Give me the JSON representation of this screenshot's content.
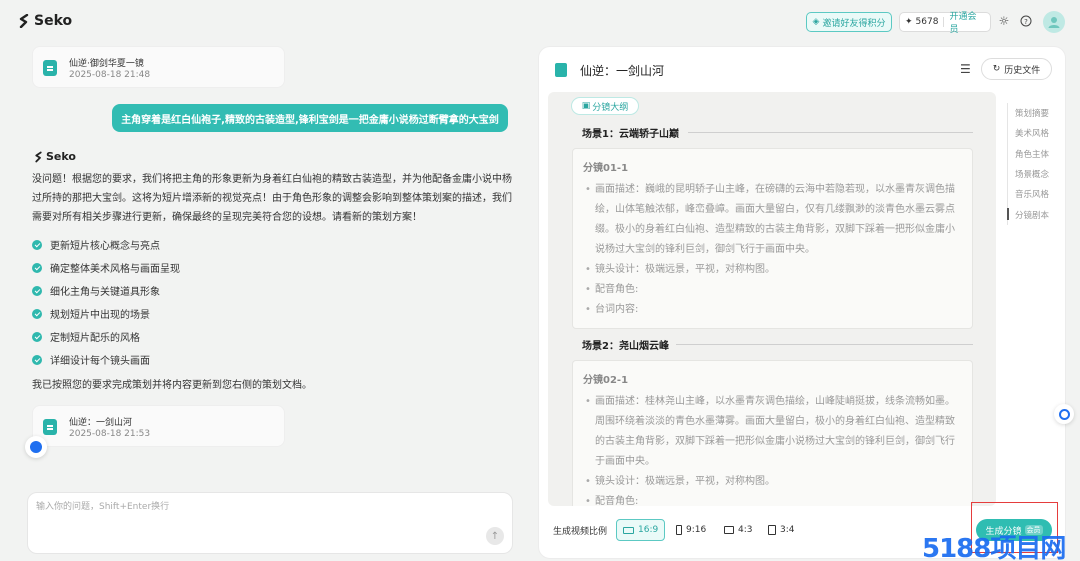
{
  "header": {
    "logo_text": "Seko",
    "invite_label": "邀请好友得积分",
    "credits_value": "5678",
    "vip_label": "开通会员"
  },
  "chat": {
    "file_cards": [
      {
        "name": "仙逆·御剑华夏一镜",
        "date": "2025-08-18 21:48"
      },
      {
        "name": "仙逆：一剑山河",
        "date": "2025-08-18 21:53"
      }
    ],
    "user_message": "主角穿着是红白仙袍子,精致的古装造型,锋利宝剑是一把金庸小说杨过断臂拿的大宝剑",
    "bot_name": "Seko",
    "bot_paragraph": "没问题！根据您的要求，我们将把主角的形象更新为身着红白仙袍的精致古装造型，并为他配备金庸小说中杨过所持的那把大宝剑。这将为短片增添新的视觉亮点！由于角色形象的调整会影响到整体策划案的描述，我们需要对所有相关步骤进行更新，确保最终的呈现完美符合您的设想。请看新的策划方案！",
    "checklist": [
      "更新短片核心概念与亮点",
      "确定整体美术风格与画面呈现",
      "细化主角与关键道具形象",
      "规划短片中出现的场景",
      "定制短片配乐的风格",
      "详细设计每个镜头画面"
    ],
    "bot_closing": "我已按照您的要求完成策划并将内容更新到您右侧的策划文档。",
    "input_placeholder": "输入你的问题，Shift+Enter换行"
  },
  "panel": {
    "title": "仙逆：一剑山河",
    "history_label": "历史文件",
    "storyboard_tag": "分镜大纲",
    "scenes": [
      {
        "title": "场景1：云端轿子山巅",
        "shot_id": "分镜01-1",
        "items": [
          "画面描述：巍峨的昆明轿子山主峰，在磅礴的云海中若隐若现，以水墨青灰调色描绘，山体笔触浓郁，峰峦叠嶂。画面大量留白，仅有几缕飘渺的淡青色水墨云雾点缀。极小的身着红白仙袍、造型精致的古装主角背影，双脚下踩着一把形似金庸小说杨过大宝剑的锋利巨剑，御剑飞行于画面中央。",
          "镜头设计：极端远景，平视，对称构图。",
          "配音角色:",
          "台词内容:"
        ]
      },
      {
        "title": "场景2：尧山烟云峰",
        "shot_id": "分镜02-1",
        "items": [
          "画面描述：桂林尧山主峰，以水墨青灰调色描绘，山峰陡峭挺拔，线条流畅如墨。周围环绕着淡淡的青色水墨薄雾。画面大量留白，极小的身着红白仙袍、造型精致的古装主角背影，双脚下踩着一把形似金庸小说杨过大宝剑的锋利巨剑，御剑飞行于画面中央。",
          "镜头设计：极端远景，平视，对称构图。",
          "配音角色:"
        ]
      }
    ],
    "toc": [
      "策划摘要",
      "美术风格",
      "角色主体",
      "场景概念",
      "音乐风格",
      "分镜剧本"
    ],
    "toc_active_index": 5,
    "ratio_label": "生成视频比例",
    "ratios": [
      "16:9",
      "9:16",
      "4:3",
      "3:4"
    ],
    "ratio_selected": "16:9",
    "generate_label": "生成分镜",
    "generate_badge": "会员"
  },
  "watermark": "5188项目网",
  "colors": {
    "accent": "#32bcb3",
    "highlight_box": "#e53d3d",
    "watermark": "#1a6cf0"
  }
}
